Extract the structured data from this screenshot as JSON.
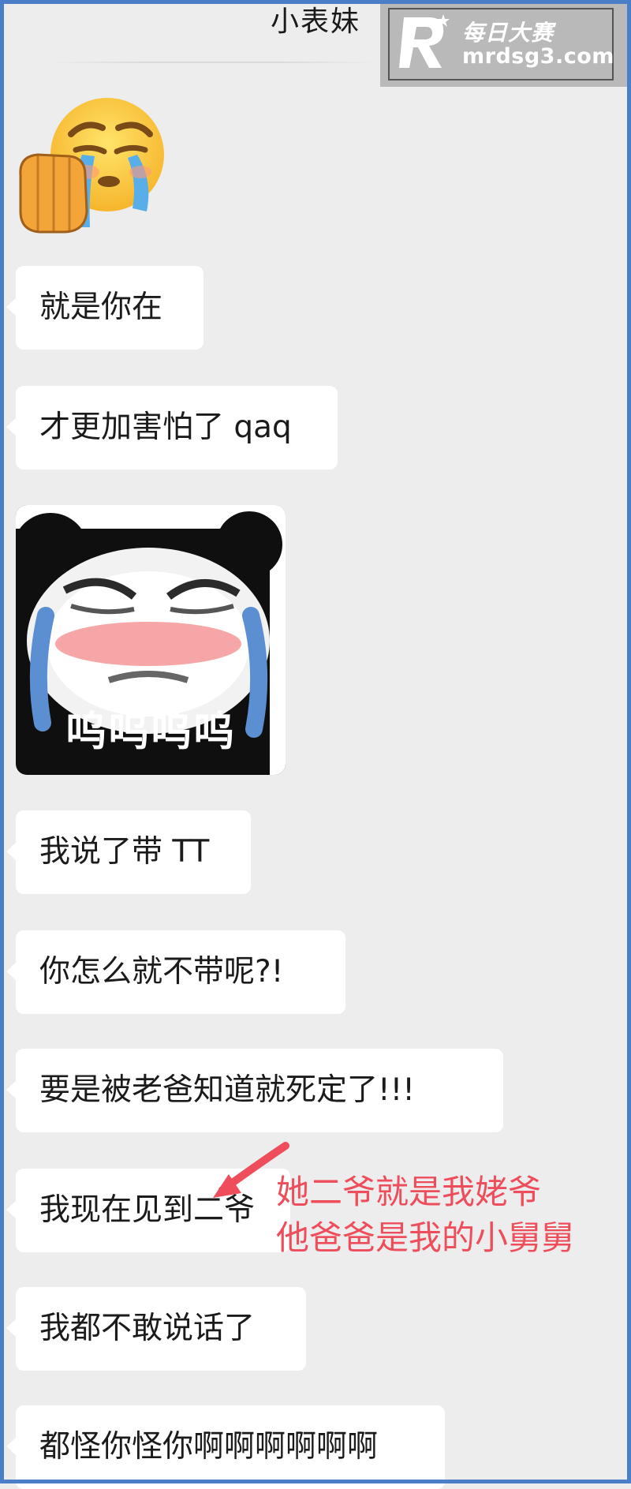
{
  "chat": {
    "title": "小表妹"
  },
  "watermark": {
    "text_cn": "每日大赛",
    "text_url": "mrdsg3.com"
  },
  "stickers": {
    "crying_emoji": "crying-face-emoji",
    "panda_caption": "呜呜呜呜"
  },
  "messages": [
    "就是你在",
    "才更加害怕了 qaq",
    "我说了带 TT",
    "你怎么就不带呢?!",
    "要是被老爸知道就死定了!!!",
    "我现在见到二爷",
    "我都不敢说话了",
    "都怪你怪你啊啊啊啊啊啊"
  ],
  "annotation": {
    "line1": "她二爷就是我姥爷",
    "line2": "他爸爸是我的小舅舅",
    "color": "#ee4e5b"
  },
  "colors": {
    "background": "#ededed",
    "bubble": "#ffffff",
    "frame": "#4a7fc8"
  }
}
